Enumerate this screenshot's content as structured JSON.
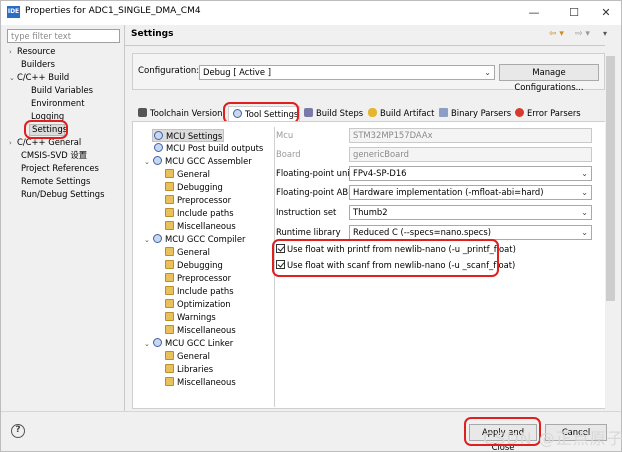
{
  "window": {
    "title": "Properties for ADC1_SINGLE_DMA_CM4",
    "icon": "ide-icon"
  },
  "filter": {
    "placeholder": "type filter text"
  },
  "nav": {
    "resource": "Resource",
    "builders": "Builders",
    "cc_build": "C/C++ Build",
    "build_variables": "Build Variables",
    "environment": "Environment",
    "logging": "Logging",
    "settings": "Settings",
    "cc_general": "C/C++ General",
    "cmsis_svd": "CMSIS-SVD 设置",
    "project_references": "Project References",
    "remote_settings": "Remote Settings",
    "run_debug": "Run/Debug Settings"
  },
  "section_title": "Settings",
  "configuration": {
    "label": "Configuration:",
    "value": "Debug  [ Active ]",
    "manage_button": "Manage Configurations..."
  },
  "tabs": [
    "Toolchain Version",
    "Tool Settings",
    "Build Steps",
    "Build Artifact",
    "Binary Parsers",
    "Error Parsers"
  ],
  "tool_tree": {
    "mcu_settings": "MCU Settings",
    "mcu_post_build": "MCU Post build outputs",
    "gcc_assembler": "MCU GCC Assembler",
    "asm_children": [
      "General",
      "Debugging",
      "Preprocessor",
      "Include paths",
      "Miscellaneous"
    ],
    "gcc_compiler": "MCU GCC Compiler",
    "cc_children": [
      "General",
      "Debugging",
      "Preprocessor",
      "Include paths",
      "Optimization",
      "Warnings",
      "Miscellaneous"
    ],
    "gcc_linker": "MCU GCC Linker",
    "ld_children": [
      "General",
      "Libraries",
      "Miscellaneous"
    ]
  },
  "mcu_settings": {
    "mcu_label": "Mcu",
    "mcu_value": "STM32MP157DAAx",
    "board_label": "Board",
    "board_value": "genericBoard",
    "fp_unit_label": "Floating-point unit",
    "fp_unit_value": "FPv4-SP-D16",
    "fp_abi_label": "Floating-point ABI",
    "fp_abi_value": "Hardware implementation (-mfloat-abi=hard)",
    "instruction_set_label": "Instruction set",
    "instruction_set_value": "Thumb2",
    "runtime_library_label": "Runtime library",
    "runtime_library_value": "Reduced C (--specs=nano.specs)",
    "printf_float": "Use float with printf from newlib-nano (-u _printf_float)",
    "scanf_float": "Use float with scanf from newlib-nano (-u _scanf_float)"
  },
  "footer": {
    "apply_close": "Apply and Close",
    "cancel": "Cancel",
    "watermark": "CSDN @正点原子"
  },
  "accent": {
    "highlight_red": "#e0201e",
    "selection": "#dcdcdc"
  }
}
